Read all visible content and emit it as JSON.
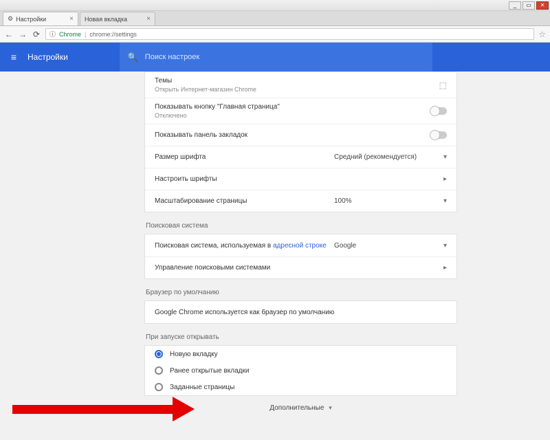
{
  "window": {
    "min": "_",
    "max": "▭",
    "close": "✕"
  },
  "tabs": [
    {
      "icon": "⚙",
      "label": "Настройки"
    },
    {
      "icon": "",
      "label": "Новая вкладка"
    }
  ],
  "nav": {
    "back": "←",
    "fwd": "→",
    "reload": "⟳"
  },
  "omnibox": {
    "icon": "ⓘ",
    "host": "Chrome",
    "sep": "|",
    "path": "chrome://settings"
  },
  "header": {
    "menu": "≡",
    "title": "Настройки",
    "search_icon": "🔍",
    "search_ph": "Поиск настроек"
  },
  "appearance": {
    "themes": {
      "label": "Темы",
      "sub": "Открыть Интернет-магазин Chrome",
      "ext": "⬚"
    },
    "home_btn": {
      "label": "Показывать кнопку \"Главная страница\"",
      "sub": "Отключено"
    },
    "bookmarks_bar": {
      "label": "Показывать панель закладок"
    },
    "font_size": {
      "label": "Размер шрифта",
      "value": "Средний (рекомендуется)"
    },
    "custom_fonts": {
      "label": "Настроить шрифты"
    },
    "zoom": {
      "label": "Масштабирование страницы",
      "value": "100%"
    }
  },
  "search": {
    "section": "Поисковая система",
    "engine": {
      "label_a": "Поисковая система, используемая в ",
      "label_b": "адресной строке",
      "value": "Google"
    },
    "manage": {
      "label": "Управление поисковыми системами"
    }
  },
  "default_browser": {
    "section": "Браузер по умолчанию",
    "text": "Google Chrome используется как браузер по умолчанию"
  },
  "startup": {
    "section": "При запуске открывать",
    "o1": "Новую вкладку",
    "o2": "Ранее открытые вкладки",
    "o3": "Заданные страницы"
  },
  "advanced": {
    "label": "Дополнительные",
    "caret": "▾"
  },
  "chev": "▾",
  "arrow_r": "▸"
}
